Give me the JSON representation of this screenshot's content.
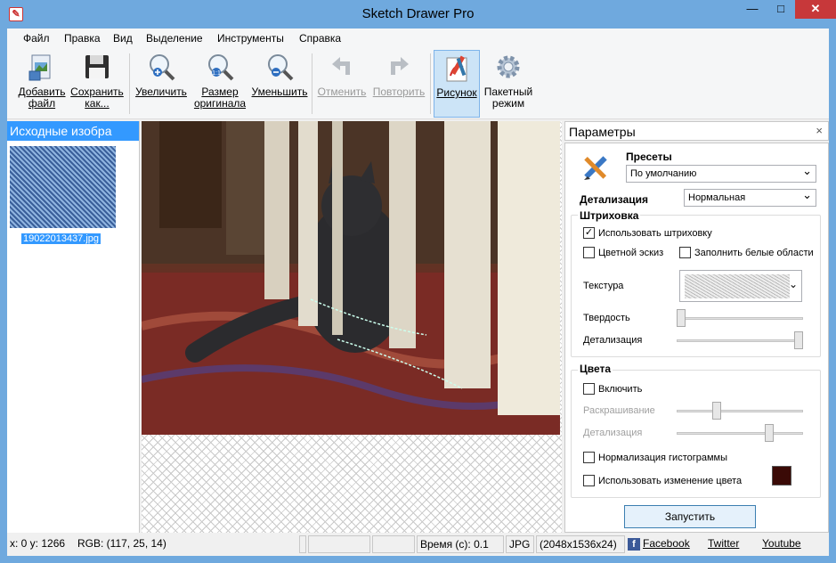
{
  "window": {
    "title": "Sketch Drawer Pro",
    "minimize": "—",
    "maximize": "□",
    "close": "✕"
  },
  "menu": [
    "Файл",
    "Правка",
    "Вид",
    "Выделение",
    "Инструменты",
    "Справка"
  ],
  "toolbar": {
    "add_file": [
      "Добавить",
      "файл"
    ],
    "save_as": [
      "Сохранить",
      "как..."
    ],
    "zoom_in": "Увеличить",
    "original_size": [
      "Размер",
      "оригинала"
    ],
    "zoom_out": "Уменьшить",
    "undo": "Отменить",
    "redo": "Повторить",
    "drawing": "Рисунок",
    "batch_mode": [
      "Пакетный",
      "режим"
    ]
  },
  "left_panel": {
    "title": "Исходные изобра",
    "thumbnail_label": "19022013437.jpg"
  },
  "params": {
    "title": "Параметры",
    "close": "×",
    "presets_label": "Пресеты",
    "preset_value": "По умолчанию",
    "detail_label": "Детализация",
    "detail_value": "Нормальная",
    "hatching_group": "Штриховка",
    "use_hatching": "Использовать штриховку",
    "use_hatching_checked": true,
    "color_sketch": "Цветной эскиз",
    "color_sketch_checked": false,
    "fill_white": "Заполнить белые области",
    "fill_white_checked": false,
    "texture_label": "Текстура",
    "hardness_label": "Твердость",
    "hardness_level": 0.0,
    "hatch_detail_label": "Детализация",
    "hatch_detail_level": 1.0,
    "colors_group": "Цвета",
    "enable_label": "Включить",
    "enable_checked": false,
    "coloring_label": "Раскрашивание",
    "coloring_level": 0.3,
    "color_detail_label": "Детализация",
    "color_detail_level": 0.75,
    "histogram_label": "Нормализация гистограммы",
    "histogram_checked": false,
    "color_change_label": "Использовать изменение цвета",
    "color_change_checked": false,
    "swatch_color": "#3a0a06",
    "run_button": "Запустить"
  },
  "status": {
    "coords": "x: 0 y: 1266",
    "rgb": "RGB: (117, 25, 14)",
    "time": "Время (с): 0.1",
    "format": "JPG",
    "dimensions": "(2048x1536x24)",
    "facebook": "Facebook",
    "twitter": "Twitter",
    "youtube": "Youtube"
  }
}
